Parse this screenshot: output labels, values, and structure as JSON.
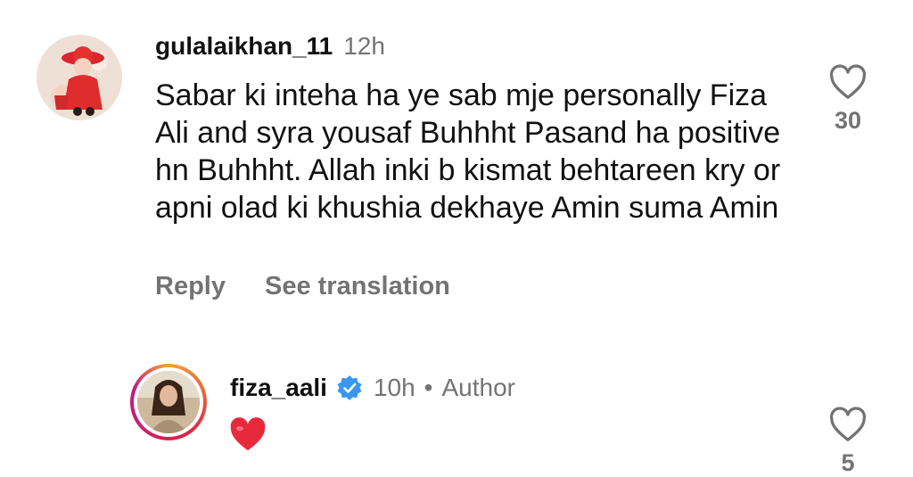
{
  "comments": [
    {
      "username": "gulalaikhan_11",
      "time": "12h",
      "text": "Sabar ki inteha ha ye sab mje personally Fiza Ali and syra yousaf Buhhht Pasand ha positive hn Buhhht. Allah inki b kismat behtareen kry or apni olad ki khushia dekhaye Amin suma Amin",
      "reply_label": "Reply",
      "translation_label": "See translation",
      "like_count": "30"
    },
    {
      "username": "fiza_aali",
      "time": "10h",
      "separator": "•",
      "author_label": "Author",
      "text_emoji": "heart",
      "like_count": "5"
    }
  ],
  "colors": {
    "text": "#111111",
    "muted": "#737373",
    "verified": "#3897f0",
    "heart": "#e8293b"
  }
}
